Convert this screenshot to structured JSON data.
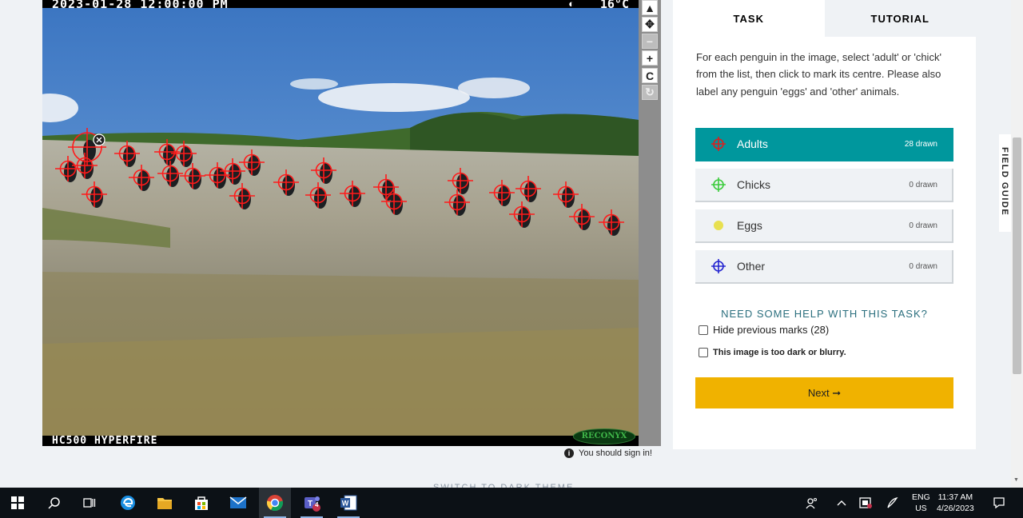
{
  "image": {
    "timestamp": "2023-01-28 12:00:00 PM",
    "temperature": "16°C",
    "camera_model": "HC500 HYPERFIRE",
    "logo": "RECONYX",
    "marker_count": 28
  },
  "toolbar": {
    "tools": [
      {
        "name": "pointer-tool",
        "icon": "▲"
      },
      {
        "name": "pan-tool",
        "icon": "✥"
      },
      {
        "name": "zoom-out-tool",
        "icon": "−"
      },
      {
        "name": "zoom-in-tool",
        "icon": "+"
      },
      {
        "name": "rotate-tool",
        "icon": "C"
      },
      {
        "name": "reset-tool",
        "icon": "↻"
      }
    ]
  },
  "sign_in_notice": "You should sign in!",
  "tabs": {
    "task": "TASK",
    "tutorial": "TUTORIAL"
  },
  "task": {
    "instructions": "For each penguin in the image, select 'adult' or 'chick' from the list, then click to mark its centre. Please also label any penguin 'eggs' and 'other' animals.",
    "options": [
      {
        "label": "Adults",
        "count": "28 drawn",
        "color": "#d92020"
      },
      {
        "label": "Chicks",
        "count": "0 drawn",
        "color": "#3ccc3c"
      },
      {
        "label": "Eggs",
        "count": "0 drawn",
        "color": "#e8e050"
      },
      {
        "label": "Other",
        "count": "0 drawn",
        "color": "#2424d0"
      }
    ],
    "help_link": "NEED SOME HELP WITH THIS TASK?",
    "hide_marks": "Hide previous marks (28)",
    "too_dark": "This image is too dark or blurry.",
    "next_label": "Next ➞"
  },
  "field_guide": "FIELD GUIDE",
  "dark_theme": "SWITCH TO DARK THEME",
  "taskbar": {
    "language": [
      "ENG",
      "US"
    ],
    "time": "11:37 AM",
    "date": "4/26/2023",
    "teams_badge": "4"
  },
  "colors": {
    "accent": "#00979d",
    "next": "#f0b200",
    "marker": "#ff1a1a"
  }
}
